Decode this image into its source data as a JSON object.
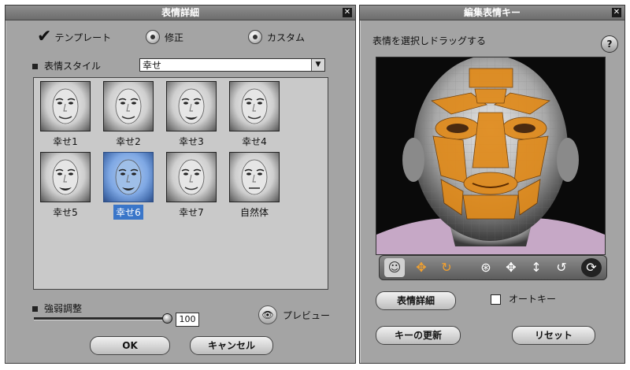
{
  "left_dialog": {
    "title": "表情詳細",
    "close": "✕",
    "modes": [
      {
        "label": "テンプレート",
        "selected": true
      },
      {
        "label": "修正",
        "selected": false
      },
      {
        "label": "カスタム",
        "selected": false
      }
    ],
    "style_label": "表情スタイル",
    "style_value": "幸せ",
    "presets": [
      {
        "label": "幸せ1",
        "mouth": "smile"
      },
      {
        "label": "幸せ2",
        "mouth": "smile"
      },
      {
        "label": "幸せ3",
        "mouth": "open"
      },
      {
        "label": "幸せ4",
        "mouth": "smile"
      },
      {
        "label": "幸せ5",
        "mouth": "open"
      },
      {
        "label": "幸せ6",
        "mouth": "open",
        "selected": true
      },
      {
        "label": "幸せ7",
        "mouth": "smile"
      },
      {
        "label": "自然体",
        "mouth": "neutral"
      }
    ],
    "strength_label": "強弱調整",
    "strength_value": "100",
    "strength_fraction": 1.0,
    "preview_label": "プレビュー",
    "ok_label": "OK",
    "cancel_label": "キャンセル"
  },
  "right_dialog": {
    "title": "編集表情キー",
    "close": "✕",
    "instruction": "表情を選択しドラッグする",
    "help": "?",
    "toolbar_icons": [
      "face-icon",
      "move-part-icon",
      "rotate-part-icon",
      "orbit-icon",
      "pan-icon",
      "zoom-icon",
      "rotate-icon",
      "reset-view-icon"
    ],
    "detail_button": "表情詳細",
    "autokey_label": "オートキー",
    "autokey_checked": false,
    "update_key_button": "キーの更新",
    "reset_button": "リセット"
  },
  "colors": {
    "panel": "#a4a4a4",
    "highlight": "#3a76c9",
    "face_region": "#e08a1a"
  }
}
